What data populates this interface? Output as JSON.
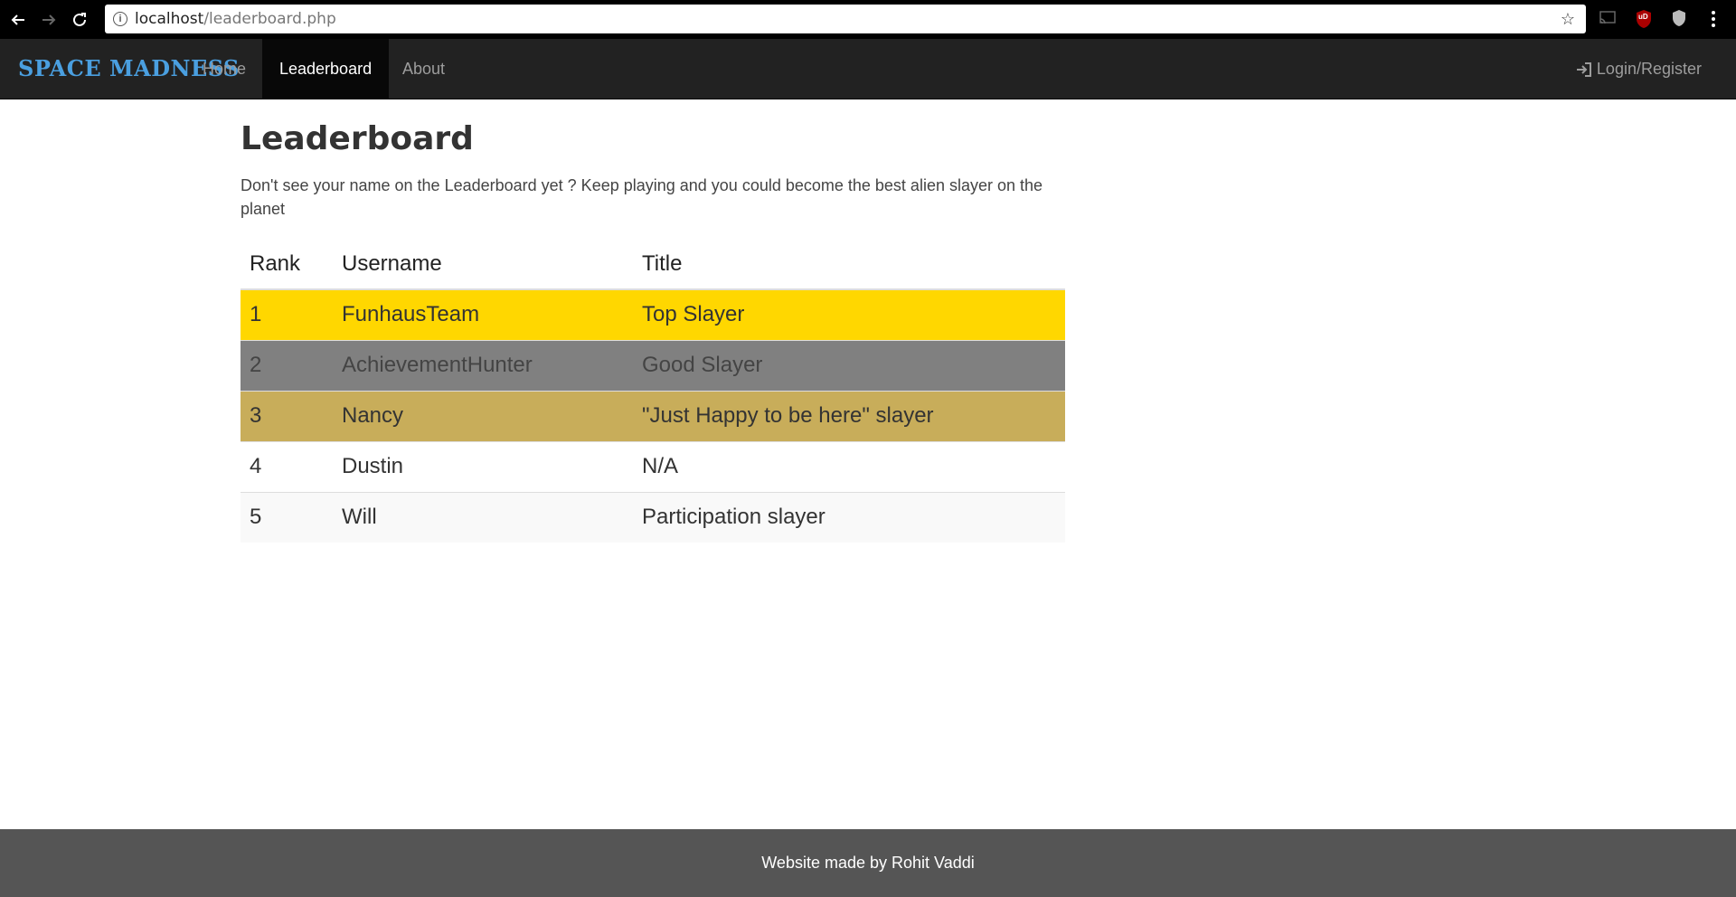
{
  "browser": {
    "url_host": "localhost",
    "url_path": "/leaderboard.php",
    "info_glyph": "i",
    "star_glyph": "☆",
    "ublock_label": "uD"
  },
  "navbar": {
    "brand": "SPACE MADNESS",
    "items": [
      {
        "label": "Home"
      },
      {
        "label": "Leaderboard"
      },
      {
        "label": "About"
      }
    ],
    "login_label": "Login/Register",
    "brand_color": "#4a9fe0"
  },
  "main": {
    "title": "Leaderboard",
    "lead": "Don't see your name on the Leaderboard yet ? Keep playing and you could become the best alien slayer on the planet",
    "table": {
      "headers": [
        "Rank",
        "Username",
        "Title"
      ],
      "rows": [
        {
          "rank": "1",
          "username": "FunhausTeam",
          "title": "Top Slayer",
          "color": "#ffd700"
        },
        {
          "rank": "2",
          "username": "AchievementHunter",
          "title": "Good Slayer",
          "color": "#808080"
        },
        {
          "rank": "3",
          "username": "Nancy",
          "title": "\"Just Happy to be here\" slayer",
          "color": "#c8ad5a"
        },
        {
          "rank": "4",
          "username": "Dustin",
          "title": "N/A",
          "color": "#ffffff"
        },
        {
          "rank": "5",
          "username": "Will",
          "title": "Participation slayer",
          "color": "#f9f9f9"
        }
      ]
    }
  },
  "footer": {
    "text": "Website made by Rohit Vaddi"
  }
}
